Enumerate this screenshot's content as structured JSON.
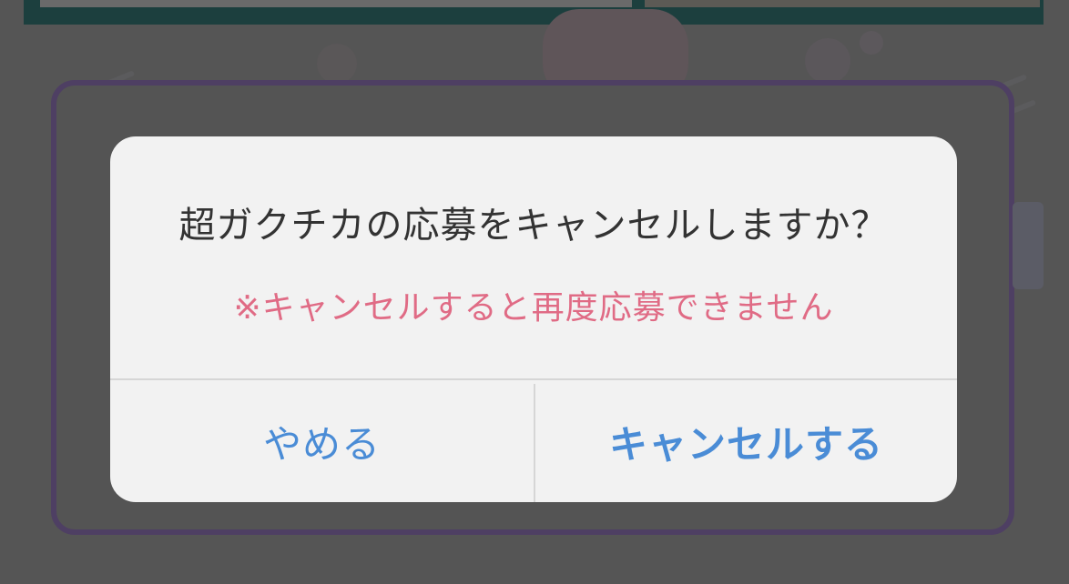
{
  "dialog": {
    "title": "超ガクチカの応募をキャンセルしますか？",
    "message": "※キャンセルすると再度応募できません",
    "dismiss_label": "やめる",
    "confirm_label": "キャンセルする"
  },
  "colors": {
    "overlay": "#555555",
    "dialog_background": "#f2f2f2",
    "title_text": "#333333",
    "warning_text": "#e06b85",
    "button_text": "#4a8cd6",
    "card_border": "#4e3f63"
  }
}
